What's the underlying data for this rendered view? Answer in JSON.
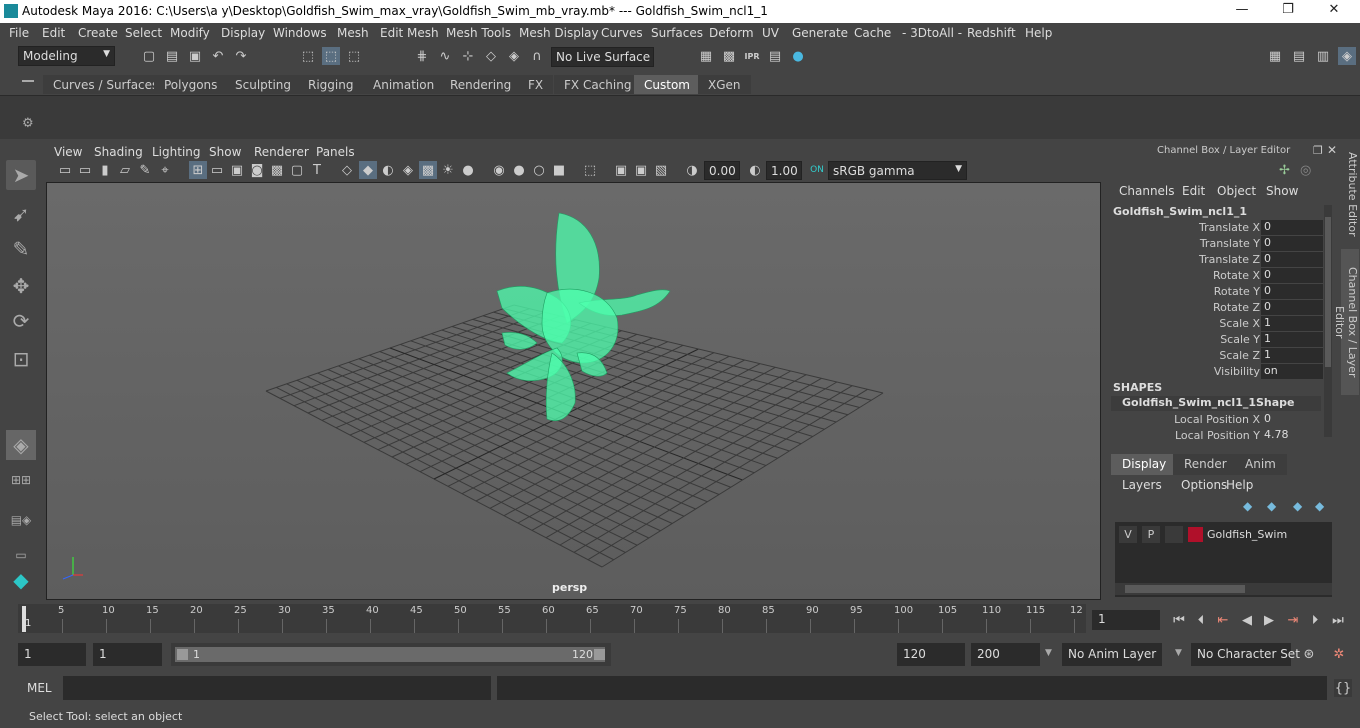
{
  "title": "Autodesk Maya 2016: C:\\Users\\a y\\Desktop\\Goldfish_Swim_max_vray\\Goldfish_Swim_mb_vray.mb*    ---    Goldfish_Swim_ncl1_1",
  "window_buttons": [
    "—",
    "❐",
    "✕"
  ],
  "menu": [
    "File",
    "Edit",
    "Create",
    "Select",
    "Modify",
    "Display",
    "Windows",
    "Mesh",
    "Edit Mesh",
    "Mesh Tools",
    "Mesh Display",
    "Curves",
    "Surfaces",
    "Deform",
    "UV",
    "Generate",
    "Cache",
    "- 3DtoAll -",
    "Redshift",
    "Help"
  ],
  "mode_select": "Modeling",
  "live_surface": "No Live Surface",
  "shelf_tabs": [
    "Curves / Surfaces",
    "Polygons",
    "Sculpting",
    "Rigging",
    "Animation",
    "Rendering",
    "FX",
    "FX Caching",
    "Custom",
    "XGen"
  ],
  "active_shelf_tab": "Custom",
  "viewport_menu": [
    "View",
    "Shading",
    "Lighting",
    "Show",
    "Renderer",
    "Panels"
  ],
  "viewport_fields": {
    "exposure": "0.00",
    "gamma": "1.00",
    "color_space": "sRGB gamma"
  },
  "camera_label": "persp",
  "channel_box": {
    "title": "Channel Box / Layer Editor",
    "menus": [
      "Channels",
      "Edit",
      "Object",
      "Show"
    ],
    "object": "Goldfish_Swim_ncl1_1",
    "attrs": [
      {
        "label": "Translate X",
        "value": "0"
      },
      {
        "label": "Translate Y",
        "value": "0"
      },
      {
        "label": "Translate Z",
        "value": "0"
      },
      {
        "label": "Rotate X",
        "value": "0"
      },
      {
        "label": "Rotate Y",
        "value": "0"
      },
      {
        "label": "Rotate Z",
        "value": "0"
      },
      {
        "label": "Scale X",
        "value": "1"
      },
      {
        "label": "Scale Y",
        "value": "1"
      },
      {
        "label": "Scale Z",
        "value": "1"
      },
      {
        "label": "Visibility",
        "value": "on"
      }
    ],
    "shapes_header": "SHAPES",
    "shape_name": "Goldfish_Swim_ncl1_1Shape",
    "shape_attrs": [
      {
        "label": "Local Position X",
        "value": "0"
      },
      {
        "label": "Local Position Y",
        "value": "4.78"
      }
    ]
  },
  "layer_editor": {
    "tabs": [
      "Display",
      "Render",
      "Anim"
    ],
    "menus": [
      "Layers",
      "Options",
      "Help"
    ],
    "layer": {
      "v": "V",
      "p": "P",
      "name": "Goldfish_Swim",
      "color": "#b0102a"
    }
  },
  "side_tabs": [
    "Attribute Editor",
    "Channel Box / Layer Editor"
  ],
  "timeline": {
    "ticks": [
      "5",
      "10",
      "15",
      "20",
      "25",
      "30",
      "35",
      "40",
      "45",
      "50",
      "55",
      "60",
      "65",
      "70",
      "75",
      "80",
      "85",
      "90",
      "95",
      "100",
      "105",
      "110",
      "115",
      "12"
    ],
    "current": "1",
    "current_frame_field": "1"
  },
  "range": {
    "start": "1",
    "anim_start": "1",
    "slider_start": "1",
    "slider_end": "120",
    "end": "120",
    "anim_end": "200",
    "anim_layer": "No Anim Layer",
    "char_set": "No Character Set"
  },
  "cmd": {
    "label": "MEL"
  },
  "help_line": "Select Tool: select an object",
  "colors": {
    "wire": "#4dffad",
    "accent": "#5d5d5d",
    "layer_color": "#b0102a"
  }
}
